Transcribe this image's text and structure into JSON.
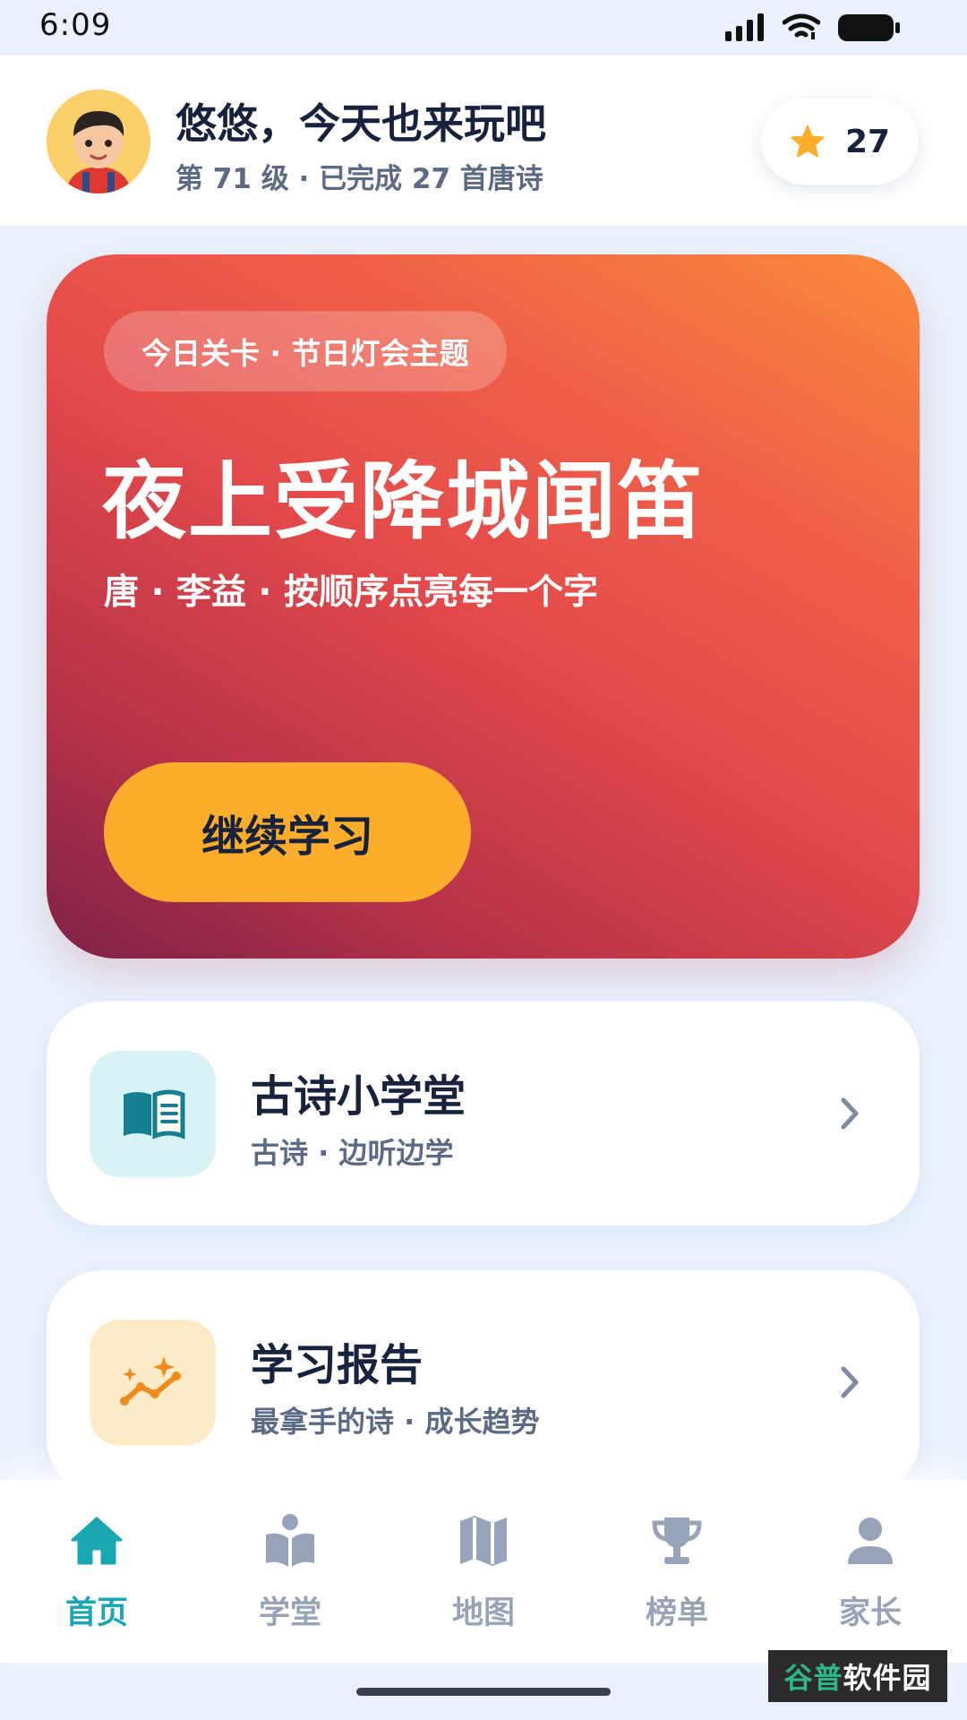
{
  "status_bar": {
    "time": "6:09",
    "icons": [
      "signal-icon",
      "wifi-icon",
      "battery-icon"
    ]
  },
  "header": {
    "avatar_icon": "boy-avatar",
    "greeting": "悠悠，今天也来玩吧",
    "level_text": "第 71 级 · 已完成 27 首唐诗",
    "stars": {
      "icon": "star-icon",
      "count": "27"
    }
  },
  "hero": {
    "tag": "今日关卡 · 节日灯会主题",
    "poem_title": "夜上受降城闻笛",
    "poem_sub": "唐 · 李益 · 按顺序点亮每一个字",
    "continue_label": "继续学习",
    "colors": {
      "gradient_start": "#7e2148",
      "gradient_mid": "#e44a4b",
      "gradient_end": "#fb8a3c",
      "button": "#fdad2c"
    }
  },
  "cards": [
    {
      "icon": "book-icon",
      "title": "古诗小学堂",
      "subtitle": "古诗 · 边听边学"
    },
    {
      "icon": "trend-chart-icon",
      "title": "学习报告",
      "subtitle": "最拿手的诗 · 成长趋势"
    }
  ],
  "tabs": [
    {
      "label": "首页",
      "icon": "home-icon",
      "active": true
    },
    {
      "label": "学堂",
      "icon": "reader-icon",
      "active": false
    },
    {
      "label": "地图",
      "icon": "map-icon",
      "active": false
    },
    {
      "label": "榜单",
      "icon": "trophy-icon",
      "active": false
    },
    {
      "label": "家长",
      "icon": "person-icon",
      "active": false
    }
  ],
  "accent_color": "#1aa7b3",
  "watermark": {
    "accent_text": "谷普",
    "text": "软件园"
  }
}
